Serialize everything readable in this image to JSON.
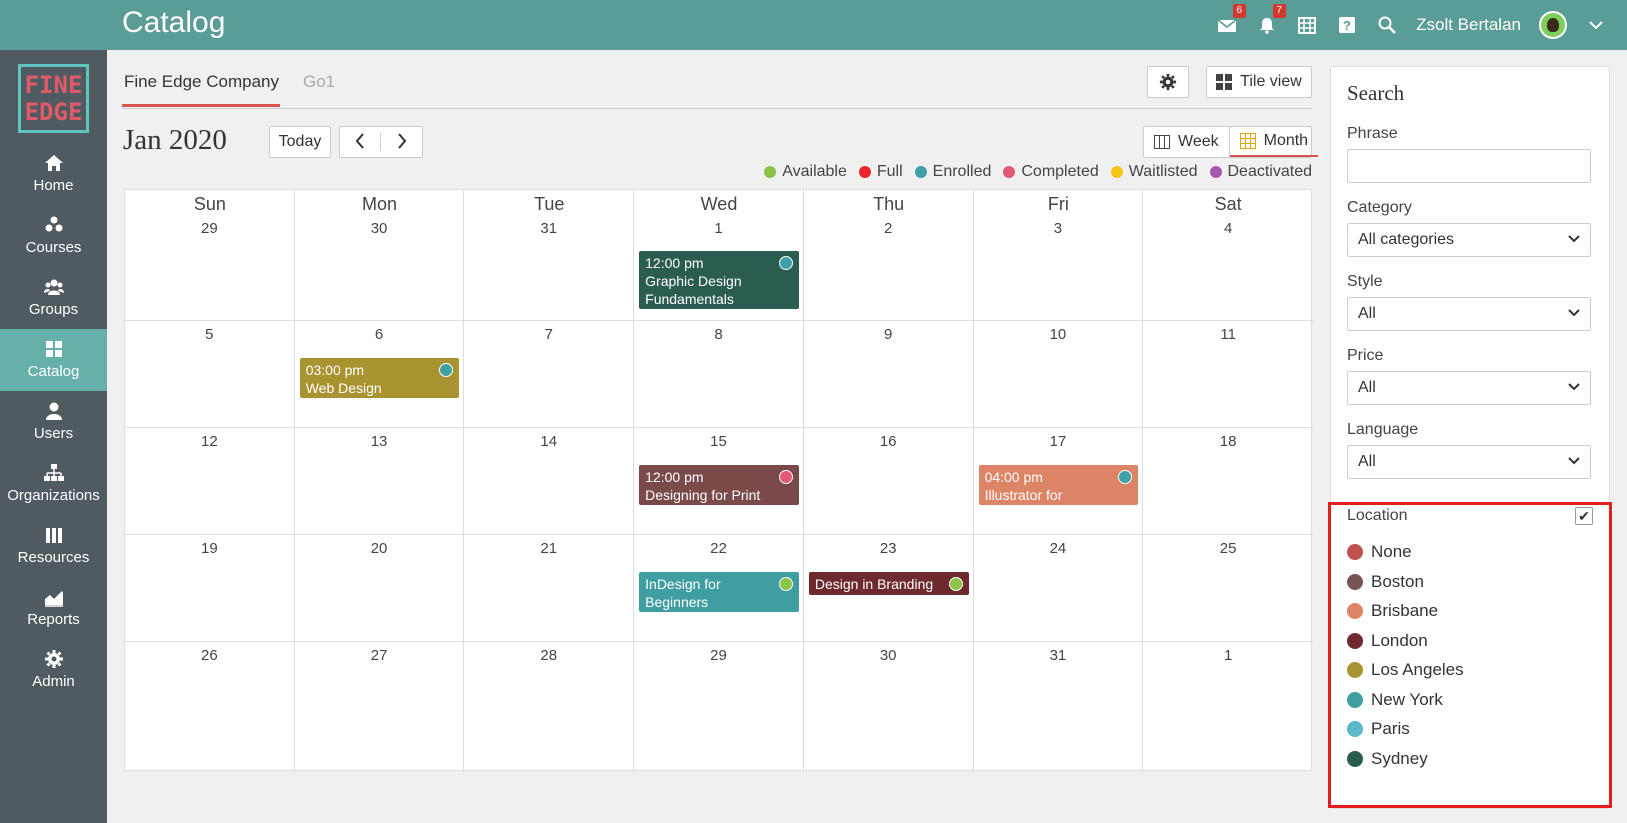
{
  "app": {
    "title": "Catalog",
    "user": "Zsolt Bertalan"
  },
  "top_icons": [
    {
      "name": "messages-icon",
      "badge": "6"
    },
    {
      "name": "notifications-icon",
      "badge": "7"
    },
    {
      "name": "calendar-icon",
      "badge": ""
    },
    {
      "name": "help-icon",
      "badge": ""
    },
    {
      "name": "search-icon",
      "badge": ""
    }
  ],
  "logo": {
    "line1": "FINE",
    "line2": "EDGE"
  },
  "sidebar": {
    "items": [
      {
        "label": "Home",
        "icon": "home-icon"
      },
      {
        "label": "Courses",
        "icon": "courses-icon"
      },
      {
        "label": "Groups",
        "icon": "groups-icon"
      },
      {
        "label": "Catalog",
        "icon": "catalog-icon",
        "active": true
      },
      {
        "label": "Users",
        "icon": "users-icon"
      },
      {
        "label": "Organizations",
        "icon": "organizations-icon"
      },
      {
        "label": "Resources",
        "icon": "resources-icon"
      },
      {
        "label": "Reports",
        "icon": "reports-icon"
      },
      {
        "label": "Admin",
        "icon": "admin-icon"
      }
    ]
  },
  "tabs": [
    {
      "label": "Fine Edge Company",
      "active": true
    },
    {
      "label": "Go1",
      "active": false
    }
  ],
  "toolbar": {
    "tile_view": "Tile view",
    "today": "Today",
    "week": "Week",
    "month": "Month"
  },
  "calendar": {
    "title": "Jan 2020",
    "days_of_week": [
      "Sun",
      "Mon",
      "Tue",
      "Wed",
      "Thu",
      "Fri",
      "Sat"
    ],
    "weeks": [
      [
        "29",
        "30",
        "31",
        "1",
        "2",
        "3",
        "4"
      ],
      [
        "5",
        "6",
        "7",
        "8",
        "9",
        "10",
        "11"
      ],
      [
        "12",
        "13",
        "14",
        "15",
        "16",
        "17",
        "18"
      ],
      [
        "19",
        "20",
        "21",
        "22",
        "23",
        "24",
        "25"
      ],
      [
        "26",
        "27",
        "28",
        "29",
        "30",
        "31",
        "1"
      ]
    ],
    "events": [
      {
        "time": "12:00 pm",
        "title": "Graphic Design Fundamentals",
        "color": "#2a5c52",
        "status_color": "#3fa0a6"
      },
      {
        "time": "03:00 pm",
        "title": "Web Design",
        "color": "#a99330",
        "status_color": "#3fa0a6"
      },
      {
        "time": "12:00 pm",
        "title": "Designing for Print",
        "color": "#7a4a4a",
        "status_color": "#e05a78"
      },
      {
        "time": "04:00 pm",
        "title": "Illustrator for Beginners",
        "color": "#dd8466",
        "status_color": "#3fa0a6"
      },
      {
        "time": "",
        "title": "InDesign for Beginners",
        "color": "#409ea2",
        "status_color": "#8bc34a"
      },
      {
        "time": "",
        "title": "Design in Branding",
        "color": "#6e2a2e",
        "status_color": "#8bc34a"
      }
    ]
  },
  "legend": [
    {
      "label": "Available",
      "color": "#8bc34a"
    },
    {
      "label": "Full",
      "color": "#e8262b"
    },
    {
      "label": "Enrolled",
      "color": "#3fa0a6"
    },
    {
      "label": "Completed",
      "color": "#e05a78"
    },
    {
      "label": "Waitlisted",
      "color": "#f5c518"
    },
    {
      "label": "Deactivated",
      "color": "#a35aa8"
    }
  ],
  "search": {
    "title": "Search",
    "phrase_label": "Phrase",
    "phrase_value": "",
    "category_label": "Category",
    "category_value": "All categories",
    "style_label": "Style",
    "style_value": "All",
    "price_label": "Price",
    "price_value": "All",
    "language_label": "Language",
    "language_value": "All",
    "location_label": "Location",
    "locations": [
      {
        "label": "None",
        "color": "#c0504d"
      },
      {
        "label": "Boston",
        "color": "#7a5454"
      },
      {
        "label": "Brisbane",
        "color": "#dd8466"
      },
      {
        "label": "London",
        "color": "#6e2a2e"
      },
      {
        "label": "Los Angeles",
        "color": "#a99330"
      },
      {
        "label": "New York",
        "color": "#409ea2"
      },
      {
        "label": "Paris",
        "color": "#5bb8c6"
      },
      {
        "label": "Sydney",
        "color": "#2a5c52"
      }
    ]
  }
}
